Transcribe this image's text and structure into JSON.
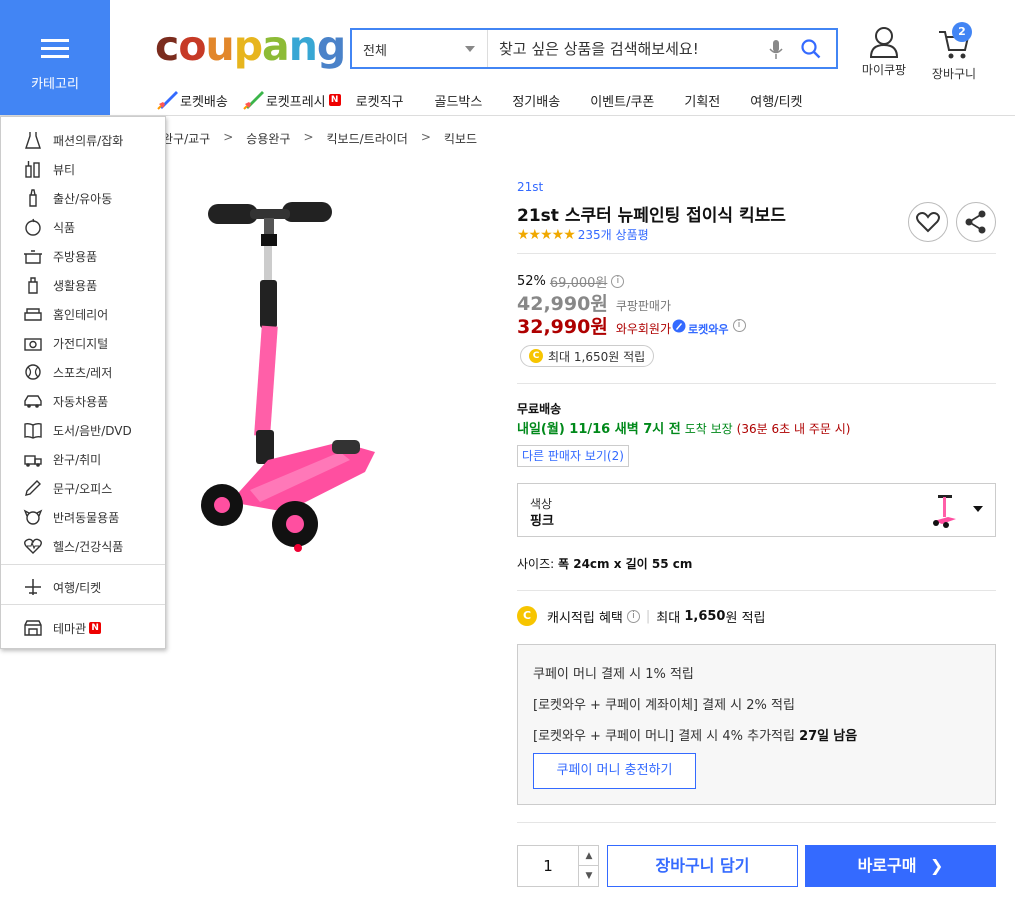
{
  "header": {
    "category_label": "카테고리",
    "logo_text": "coupang",
    "search": {
      "scope": "전체",
      "placeholder": "찾고 싶은 상품을 검색해보세요!"
    },
    "my_coupang": "마이쿠팡",
    "cart_label": "장바구니",
    "cart_count": "2",
    "nav": [
      {
        "label": "로켓배송",
        "icon": "rocket-icon"
      },
      {
        "label": "로켓프레시",
        "icon": "rocket-fresh-icon",
        "badge": "N"
      },
      {
        "label": "로켓직구"
      },
      {
        "label": "골드박스"
      },
      {
        "label": "정기배송"
      },
      {
        "label": "이벤트/쿠폰"
      },
      {
        "label": "기획전"
      },
      {
        "label": "여행/티켓"
      }
    ]
  },
  "categories": [
    {
      "label": "패션의류/잡화",
      "icon": "dress-icon"
    },
    {
      "label": "뷰티",
      "icon": "cosmetics-icon"
    },
    {
      "label": "출산/유아동",
      "icon": "baby-bottle-icon"
    },
    {
      "label": "식품",
      "icon": "apple-icon"
    },
    {
      "label": "주방용품",
      "icon": "pot-icon"
    },
    {
      "label": "생활용품",
      "icon": "detergent-icon"
    },
    {
      "label": "홈인테리어",
      "icon": "sofa-icon"
    },
    {
      "label": "가전디지털",
      "icon": "camera-icon"
    },
    {
      "label": "스포츠/레저",
      "icon": "ball-icon"
    },
    {
      "label": "자동차용품",
      "icon": "car-icon"
    },
    {
      "label": "도서/음반/DVD",
      "icon": "book-icon"
    },
    {
      "label": "완구/취미",
      "icon": "toy-icon"
    },
    {
      "label": "문구/오피스",
      "icon": "pencil-icon"
    },
    {
      "label": "반려동물용품",
      "icon": "dog-icon"
    },
    {
      "label": "헬스/건강식품",
      "icon": "health-heart-icon"
    },
    {
      "label": "여행/티켓",
      "icon": "airplane-icon"
    },
    {
      "label": "테마관",
      "icon": "theme-store-icon",
      "badge": "N"
    }
  ],
  "breadcrumb": [
    "완구/교구",
    "승용완구",
    "킥보드/트라이더",
    "킥보드"
  ],
  "breadcrumb_sep": ">",
  "product": {
    "brand": "21st",
    "title": "21st 스쿠터 뉴페인팅 접이식 킥보드",
    "rating": 4.5,
    "stars": "★★★★★",
    "review_count": "235개 상품평",
    "discount_rate": "52%",
    "original_price": "69,000원",
    "sale_price": "42,990원",
    "sale_label": "쿠팡판매가",
    "wow_price": "32,990원",
    "wow_label": "와우회원가",
    "wow_badge": "로켓와우",
    "cash_pill": "최대 1,650원 적립",
    "shipping_label": "무료배송",
    "delivery_date": "내일(월) 11/16 새벽 7시 전",
    "delivery_note": "도착 보장",
    "delivery_deadline": "(36분 6초 내 주문 시)",
    "other_sellers": "다른 판매자 보기(2)",
    "option_name": "색상",
    "option_value": "핑크",
    "size_label": "사이즈:",
    "size_value": "폭 24cm x 길이 55 cm",
    "cash_benefit": "캐시적립 혜택",
    "cash_max_prefix": "최대",
    "cash_max_amount": "1,650",
    "cash_max_suffix": "원 적립",
    "coupay_lines": {
      "l1": "쿠페이 머니 결제 시 1% 적립",
      "l2": "[로켓와우 + 쿠페이 계좌이체] 결제 시 2% 적립",
      "l3": "[로켓와우 + 쿠페이 머니] 결제 시 4% 추가적립",
      "l3_days": "27일",
      "l3_suffix": "남음"
    },
    "charge_button": "쿠페이 머니 충전하기",
    "quantity": "1",
    "add_to_cart": "장바구니 담기",
    "buy_now": "바로구매"
  },
  "colors": {
    "accent": "#346aff",
    "category_blue": "#4285f4",
    "price_red": "#ae0000",
    "delivery_green": "#00891a",
    "scooter_pink": "#ff5fa8"
  }
}
